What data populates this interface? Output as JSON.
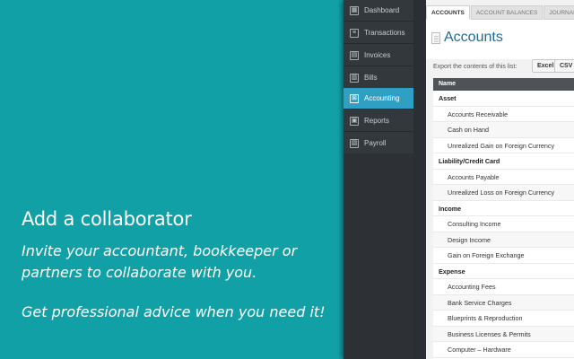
{
  "promo": {
    "title": "Add a collaborator",
    "line1": "Invite your accountant, bookkeeper or partners to collaborate with you.",
    "line2": "Get professional advice when you need it!"
  },
  "sidebar": {
    "items": [
      {
        "label": "Dashboard",
        "icon": "dashboard-icon"
      },
      {
        "label": "Transactions",
        "icon": "list-icon"
      },
      {
        "label": "Invoices",
        "icon": "invoice-icon"
      },
      {
        "label": "Bills",
        "icon": "bill-icon"
      },
      {
        "label": "Accounting",
        "icon": "accounting-icon",
        "active": true
      },
      {
        "label": "Reports",
        "icon": "reports-icon"
      },
      {
        "label": "Payroll",
        "icon": "payroll-icon"
      }
    ]
  },
  "tabs": [
    "ACCOUNTS",
    "ACCOUNT BALANCES",
    "JOURNAL"
  ],
  "page": {
    "title": "Accounts",
    "export_label": "Export the contents of this list:",
    "excel_label": "Excel",
    "csv_label": "CSV"
  },
  "table": {
    "header": "Name",
    "rows": [
      {
        "type": "group",
        "label": "Asset"
      },
      {
        "type": "item",
        "label": "Accounts Receivable"
      },
      {
        "type": "item",
        "label": "Cash on Hand"
      },
      {
        "type": "item",
        "label": "Unrealized Gain on Foreign Currency"
      },
      {
        "type": "group",
        "label": "Liability/Credit Card"
      },
      {
        "type": "item",
        "label": "Accounts Payable"
      },
      {
        "type": "item",
        "label": "Unrealized Loss on Foreign Currency"
      },
      {
        "type": "group",
        "label": "Income"
      },
      {
        "type": "item",
        "label": "Consulting Income"
      },
      {
        "type": "item",
        "label": "Design Income"
      },
      {
        "type": "item",
        "label": "Gain on Foreign Exchange"
      },
      {
        "type": "group",
        "label": "Expense"
      },
      {
        "type": "item",
        "label": "Accounting Fees"
      },
      {
        "type": "item",
        "label": "Bank Service Charges"
      },
      {
        "type": "item",
        "label": "Blueprints & Reproduction"
      },
      {
        "type": "item",
        "label": "Business Licenses & Permits"
      },
      {
        "type": "item",
        "label": "Computer – Hardware"
      }
    ]
  },
  "colors": {
    "promo_bg": "#12a0a7",
    "active_nav": "#2fa0c4",
    "title_blue": "#1f6b92"
  }
}
